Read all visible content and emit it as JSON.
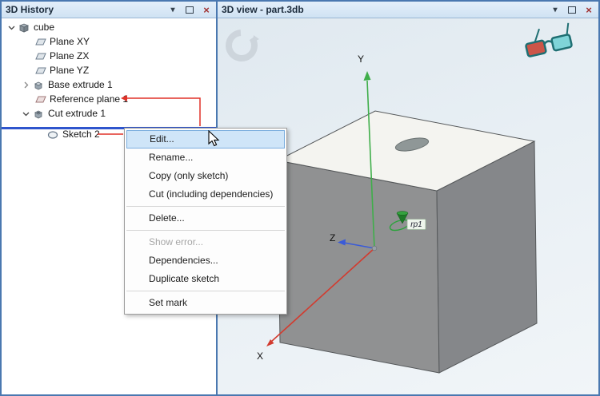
{
  "window": {
    "icons": {
      "menu": "▾",
      "close": "×"
    },
    "colors": {
      "border": "#4a78b0",
      "header_bg": "#d9e7f5",
      "selection_line": "#2f55cd",
      "annotation_red": "#e03228",
      "menu_highlight": "#cfe5f8",
      "axis_x": "#d23b2f",
      "axis_y": "#3fae4a",
      "axis_z": "#3a5bd8"
    }
  },
  "history_panel": {
    "title": "3D History",
    "tree": [
      {
        "label": "cube",
        "icon": "part-body",
        "expanded": true
      },
      {
        "label": "Plane XY",
        "icon": "plane"
      },
      {
        "label": "Plane ZX",
        "icon": "plane"
      },
      {
        "label": "Plane YZ",
        "icon": "plane"
      },
      {
        "label": "Base extrude 1",
        "icon": "extrude",
        "collapsed": true
      },
      {
        "label": "Reference plane 1",
        "icon": "reference-plane"
      },
      {
        "label": "Cut extrude 1",
        "icon": "cut-extrude",
        "expanded": true
      },
      {
        "label": "Sketch 2",
        "icon": "sketch"
      }
    ]
  },
  "context_menu": {
    "items": [
      {
        "label": "Edit...",
        "state": "highlighted"
      },
      {
        "label": "Rename...",
        "state": "normal"
      },
      {
        "label": "Copy (only sketch)",
        "state": "normal"
      },
      {
        "label": "Cut (including dependencies)",
        "state": "normal"
      },
      {
        "label": "",
        "state": "separator"
      },
      {
        "label": "Delete...",
        "state": "normal"
      },
      {
        "label": "",
        "state": "separator"
      },
      {
        "label": "Show error...",
        "state": "disabled"
      },
      {
        "label": "Dependencies...",
        "state": "normal"
      },
      {
        "label": "Duplicate sketch",
        "state": "normal"
      },
      {
        "label": "",
        "state": "separator"
      },
      {
        "label": "Set mark",
        "state": "normal"
      }
    ]
  },
  "view_panel": {
    "title": "3D view - part.3db",
    "axes": {
      "x": "X",
      "y": "Y",
      "z": "Z"
    },
    "marker_label": "rp1"
  }
}
